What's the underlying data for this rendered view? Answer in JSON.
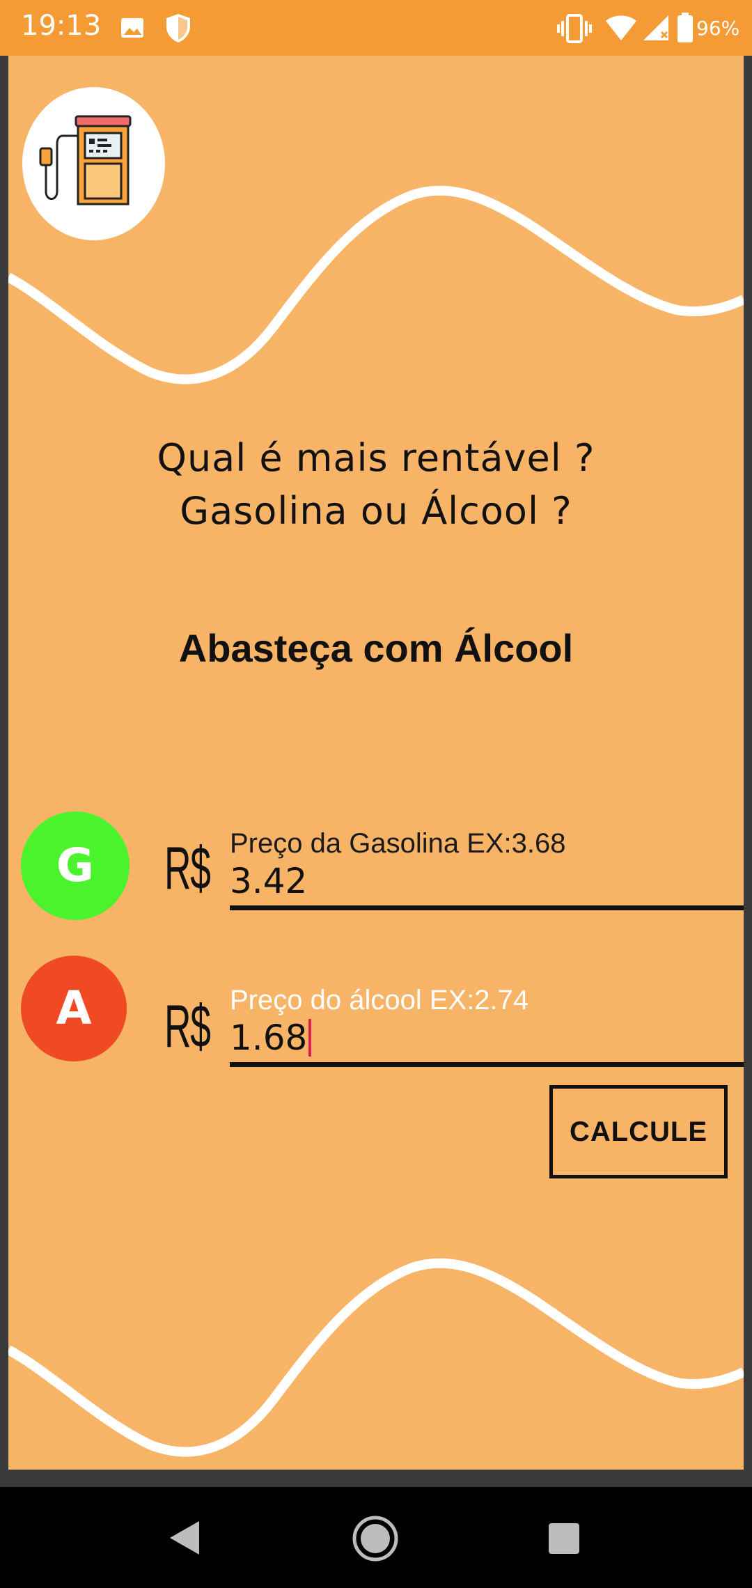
{
  "status_bar": {
    "time": "19:13",
    "battery": "96%",
    "icons": [
      "image-icon",
      "shield-icon",
      "vibrate-icon",
      "wifi-icon",
      "signal-icon",
      "battery-icon"
    ]
  },
  "main": {
    "question_line1": "Qual é mais rentável ?",
    "question_line2": "Gasolina ou Álcool ?",
    "result": "Abasteça com Álcool"
  },
  "gasoline": {
    "badge": "G",
    "currency": "R$",
    "label": "Preço da Gasolina EX:3.68",
    "value": "3.42",
    "color": "#4BF32D"
  },
  "alcohol": {
    "badge": "A",
    "currency": "R$",
    "label": "Preço do álcool EX:2.74",
    "value": "1.68",
    "color": "#F04A24"
  },
  "actions": {
    "calculate_label": "CALCULE"
  },
  "colors": {
    "status_bar": "#F49B35",
    "background": "#F8B466",
    "wave": "#FFFFFF"
  },
  "nav": {
    "icons": [
      "back-icon",
      "home-icon",
      "recents-icon"
    ]
  }
}
